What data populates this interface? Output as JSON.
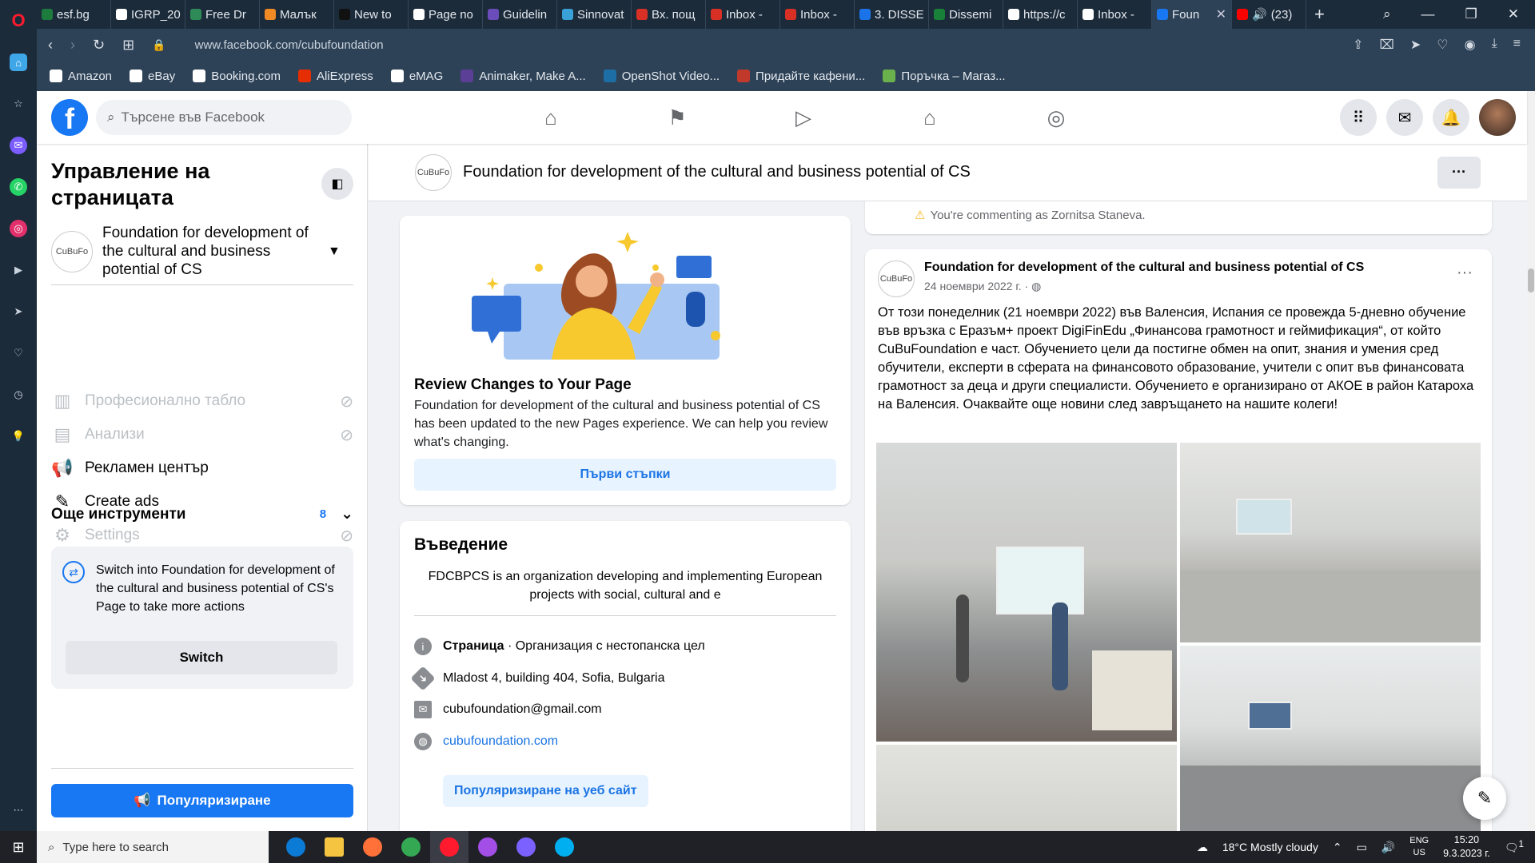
{
  "browser": {
    "tabs": [
      {
        "label": "esf.bg",
        "color": "#1e7b3e"
      },
      {
        "label": "IGRP_20",
        "color": "#ffffff"
      },
      {
        "label": "Free Dr",
        "color": "#2e8b57"
      },
      {
        "label": "Малък",
        "color": "#f08a24"
      },
      {
        "label": "New to",
        "color": "#111111"
      },
      {
        "label": "Page no",
        "color": "#ffffff"
      },
      {
        "label": "Guidelin",
        "color": "#6a4dbb"
      },
      {
        "label": "Sinnovat",
        "color": "#3aa0d8"
      },
      {
        "label": "Вх. пощ",
        "color": "#d93025"
      },
      {
        "label": "Inbox -",
        "color": "#d93025"
      },
      {
        "label": "Inbox -",
        "color": "#d93025"
      },
      {
        "label": "3. DISSE",
        "color": "#1a73e8"
      },
      {
        "label": "Dissemi",
        "color": "#188038"
      },
      {
        "label": "https://c",
        "color": "#ffffff"
      },
      {
        "label": "Inbox -",
        "color": "#ffffff"
      }
    ],
    "active_tab": {
      "label": "Foun",
      "color": "#1877f2"
    },
    "youtube_tab": {
      "label": "(23)",
      "color": "#ff0000"
    },
    "url": "www.facebook.com/cubufoundation",
    "bookmarks": [
      {
        "label": "Amazon",
        "color": "#ffffff"
      },
      {
        "label": "eBay",
        "color": "#ffffff"
      },
      {
        "label": "Booking.com",
        "color": "#ffffff"
      },
      {
        "label": "AliExpress",
        "color": "#e62e04"
      },
      {
        "label": "eMAG",
        "color": "#ffffff"
      },
      {
        "label": "Animaker, Make A...",
        "color": "#5b3e96"
      },
      {
        "label": "OpenShot Video...",
        "color": "#1c6ea4"
      },
      {
        "label": "Придайте кафени...",
        "color": "#c0392b"
      },
      {
        "label": "Поръчка – Магаз...",
        "color": "#6ab04c"
      }
    ]
  },
  "fb": {
    "search_placeholder": "Търсене във Facebook",
    "logo_letter": "f"
  },
  "left_panel": {
    "title": "Управление на страницата",
    "page_name": "Foundation for development of the cultural and business potential of CS",
    "logo_text": "CuBuFo",
    "menu": [
      {
        "label": "Професионално табло",
        "icon": "dashboard-icon",
        "glyph": "▥",
        "dim": true
      },
      {
        "label": "Анализи",
        "icon": "insights-icon",
        "glyph": "▤",
        "dim": true
      },
      {
        "label": "Рекламен център",
        "icon": "megaphone-icon",
        "glyph": "📢",
        "dim": false
      },
      {
        "label": "Create ads",
        "icon": "edit-icon",
        "glyph": "✎",
        "dim": false
      },
      {
        "label": "Settings",
        "icon": "gear-icon",
        "glyph": "⚙",
        "dim": true
      }
    ],
    "more_tools": "Още инструменти",
    "more_tools_count": "8",
    "switch_text": "Switch into Foundation for development of the cultural and business potential of CS's Page to take more actions",
    "switch_button": "Switch",
    "promote_button": "Популяризиране"
  },
  "page_header": {
    "title": "Foundation for development of the cultural and business potential of CS"
  },
  "review_card": {
    "title": "Review Changes to Your Page",
    "description": "Foundation for development of the cultural and business potential of CS has been updated to the new Pages experience. We can help you review what's changing.",
    "button": "Първи стъпки"
  },
  "intro_card": {
    "title": "Въведение",
    "bio": "FDCBPCS is an organization developing and implementing European projects with social, cultural and e",
    "category_label": "Страница",
    "category_value": " · Организация с нестопанска цел",
    "address": "Mladost 4, building 404, Sofia, Bulgaria",
    "email": "cubufoundation@gmail.com",
    "website": "cubufoundation.com",
    "promote_website": "Популяризиране на уеб сайт"
  },
  "comment_card": {
    "note": "You're commenting as Zornitsa Staneva."
  },
  "post": {
    "author": "Foundation for development of the cultural and business potential of CS",
    "date": "24 ноември 2022 г. ·",
    "text": "От този понеделник (21 ноември 2022) във Валенсия, Испания се провежда 5-дневно обучение във връзка с Еразъм+ проект DigiFinEdu „Финансова грамотност и геймификация“, от който CuBuFoundation е част. Обучението цели да постигне обмен на опит, знания и умения сред обучители, експерти в сферата на финансовото образование, учители с опит във финансовата грамотност за деца и други специалисти. Обучението е организирано от АКОЕ в район Катароха на Валенсия. Очаквайте още новини след завръщането на нашите колеги!"
  },
  "taskbar": {
    "search_placeholder": "Type here to search",
    "weather": "18°C  Mostly cloudy",
    "lang_top": "ENG",
    "lang_bottom": "US",
    "time": "15:20",
    "date": "9.3.2023 г.",
    "notification_count": "1"
  }
}
